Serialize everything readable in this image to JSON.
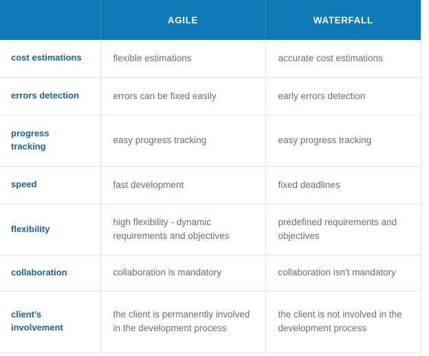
{
  "table": {
    "headers": {
      "feature": "",
      "agile": "AGILE",
      "waterfall": "WATERFALL"
    },
    "colors": {
      "header_background": "#0d79b5",
      "header_text": "#ffffff",
      "feature_label_text": "#17639f",
      "value_text": "#6e6e6e",
      "row_divider": "#e6e6e6",
      "page_background": "#ffffff"
    },
    "rows": [
      {
        "feature": "cost estimations",
        "agile": "flexible estimations",
        "waterfall": "accurate cost estimations"
      },
      {
        "feature": "errors detection",
        "agile": "errors can be fixed easily",
        "waterfall": "early errors detection"
      },
      {
        "feature": "progress\ntracking",
        "agile": "easy progress tracking",
        "waterfall": "easy progress tracking"
      },
      {
        "feature": "speed",
        "agile": "fast development",
        "waterfall": "fixed deadlines"
      },
      {
        "feature": "flexibility",
        "agile": "high flexibility - dynamic requirements and objectives",
        "waterfall": "predefined requirements and objectives"
      },
      {
        "feature": "collaboration",
        "agile": "collaboration is mandatory",
        "waterfall": "collaboration isn't mandatory"
      },
      {
        "feature": "client's\ninvolvement",
        "agile": "the client is permanently involved in the development process",
        "waterfall": "the client is not involved in the development process"
      }
    ]
  }
}
